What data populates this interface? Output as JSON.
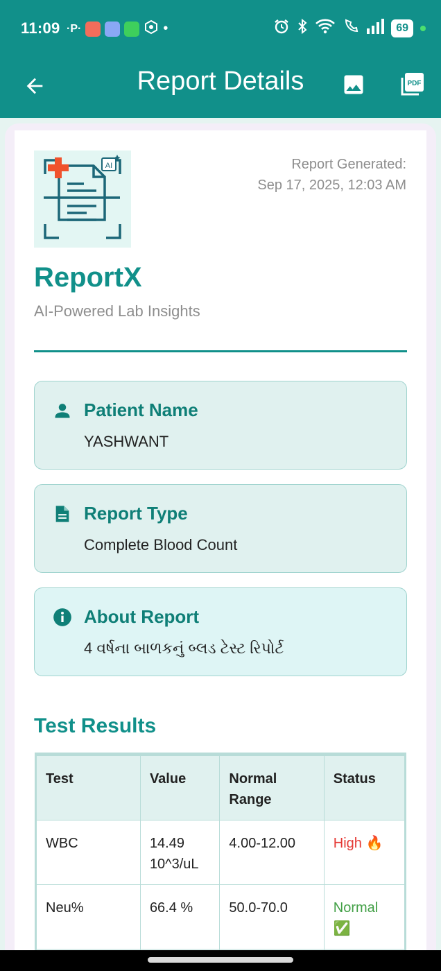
{
  "status_bar": {
    "time": "11:09",
    "battery": "69"
  },
  "app_bar": {
    "title": "Report Details",
    "back_icon": "arrow-back-icon",
    "image_icon": "image-icon",
    "pdf_icon": "pdf-icon",
    "pdf_text": "PDF"
  },
  "header": {
    "report_generated_label": "Report Generated:",
    "report_generated_date": "Sep 17, 2025, 12:03 AM",
    "brand": "ReportX",
    "tagline": "AI-Powered Lab Insights",
    "logo_ai_text": "AI"
  },
  "info_cards": {
    "patient": {
      "icon": "person-icon",
      "label": "Patient Name",
      "value": "YASHWANT"
    },
    "report_type": {
      "icon": "document-icon",
      "label": "Report Type",
      "value": "Complete Blood Count"
    },
    "about": {
      "icon": "info-icon",
      "label": "About Report",
      "value": "4 વર્ષના બાળકનું બ્લડ ટેસ્ટ રિપોર્ટ"
    }
  },
  "results": {
    "title": "Test Results",
    "columns": [
      "Test",
      "Value",
      "Normal Range",
      "Status"
    ],
    "rows": [
      {
        "test": "WBC",
        "value": "14.49 10^3/uL",
        "range": "4.00-12.00",
        "status": "High 🔥",
        "status_color": "#e53935"
      },
      {
        "test": "Neu%",
        "value": "66.4 %",
        "range": "50.0-70.0",
        "status": "Normal ✅",
        "status_color": "#43a047"
      }
    ]
  },
  "colors": {
    "primary": "#11908a",
    "high": "#e53935",
    "normal": "#43a047"
  }
}
